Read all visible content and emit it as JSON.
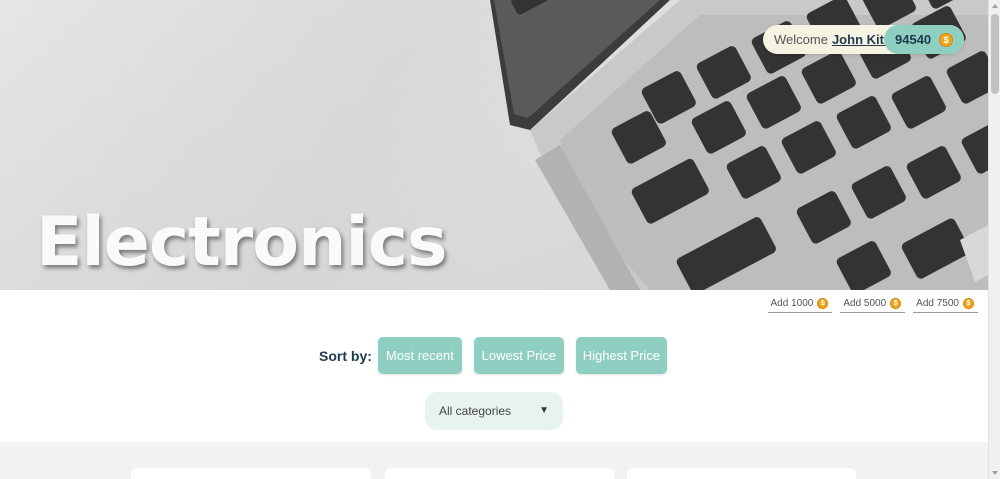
{
  "hero": {
    "title": "Electronics"
  },
  "user": {
    "welcome_text": "Welcome",
    "name": "John Kite",
    "exclamation": "!",
    "coins": "94540"
  },
  "add_coins": [
    {
      "label": "Add 1000"
    },
    {
      "label": "Add 5000"
    },
    {
      "label": "Add 7500"
    }
  ],
  "sort": {
    "label": "Sort by:",
    "options": [
      "Most recent",
      "Lowest Price",
      "Highest Price"
    ]
  },
  "category_select": {
    "selected": "All categories"
  },
  "colors": {
    "accent": "#8fcfc2",
    "coin": "#f1a51e",
    "text_dark": "#1f3a4f"
  },
  "icons": {
    "coin": "coin-icon",
    "dropdown": "chevron-down-icon"
  }
}
